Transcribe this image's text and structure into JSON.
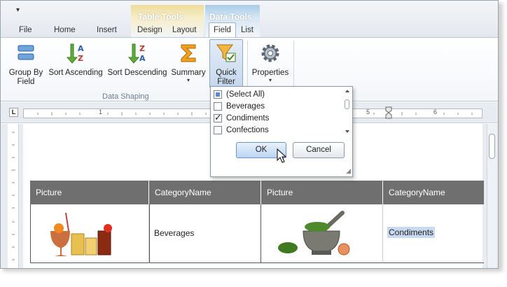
{
  "qat": {
    "menu_glyph": "▾"
  },
  "contextual": {
    "table_tools": "Table Tools",
    "data_tools": "Data Tools"
  },
  "tabs": [
    "File",
    "Home",
    "Insert",
    "Design",
    "Layout",
    "Field",
    "List"
  ],
  "ribbon": {
    "group_by": "Group By Field",
    "sort_asc": "Sort Ascending",
    "sort_desc": "Sort Descending",
    "summary": "Summary",
    "quick_filter": "Quick Filter",
    "properties": "Properties",
    "group_label": "Data Shaping",
    "dropdown_arrow": "▾"
  },
  "ruler": {
    "corner": "L",
    "numbers": [
      "1",
      "5",
      "6"
    ]
  },
  "table": {
    "headers": [
      "Picture",
      "CategoryName",
      "Picture",
      "CategoryName"
    ],
    "rows": [
      [
        "Beverages",
        "Condiments"
      ]
    ]
  },
  "filter": {
    "items": [
      {
        "label": "(Select All)",
        "state": "indeterminate"
      },
      {
        "label": "Beverages",
        "state": "unchecked"
      },
      {
        "label": "Condiments",
        "state": "checked"
      },
      {
        "label": "Confections",
        "state": "unchecked"
      }
    ],
    "ok": "OK",
    "cancel": "Cancel"
  },
  "colors": {
    "accent": "#5a8ad0",
    "table_header": "#6f6f6f",
    "table_tools": "#eedc9c",
    "data_tools": "#a8cce8"
  }
}
